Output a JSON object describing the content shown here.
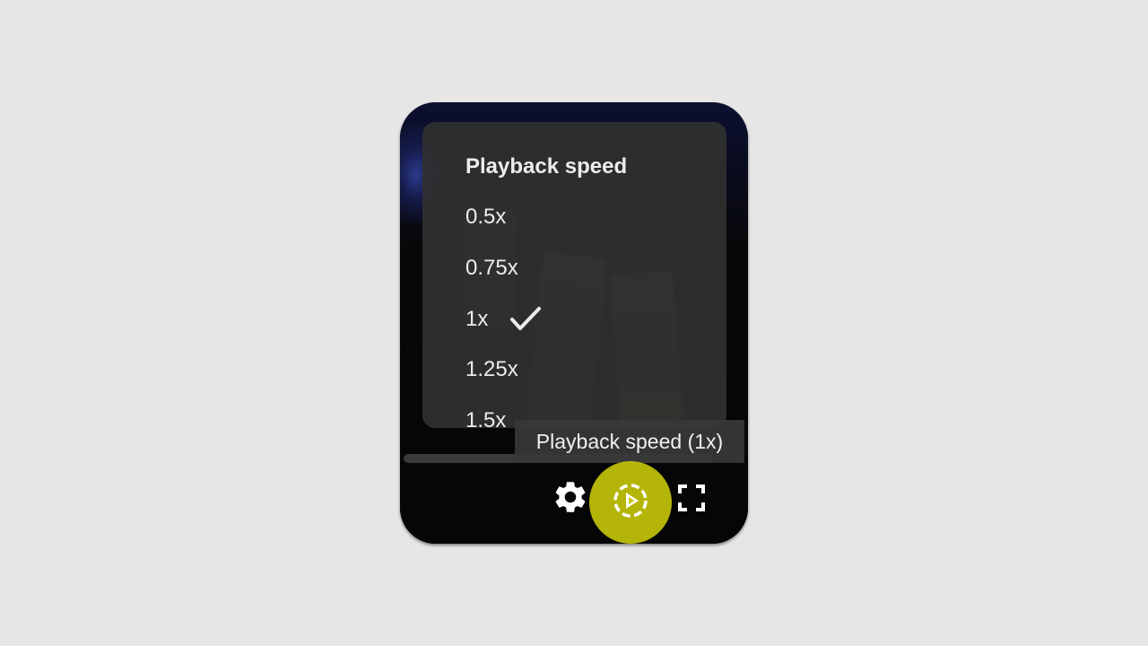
{
  "menu": {
    "title": "Playback speed",
    "options": [
      {
        "label": "0.5x",
        "selected": false
      },
      {
        "label": "0.75x",
        "selected": false
      },
      {
        "label": "1x",
        "selected": true
      },
      {
        "label": "1.25x",
        "selected": false
      },
      {
        "label": "1.5x",
        "selected": false
      }
    ]
  },
  "tooltip": {
    "text": "Playback speed (1x)"
  },
  "controls": {
    "settings_icon": "gear-icon",
    "speed_icon": "playback-speed-icon",
    "fullscreen_icon": "fullscreen-icon",
    "highlight_color": "#cdcd0a"
  },
  "colors": {
    "page_background": "#e6e6e6",
    "menu_background": "#303030",
    "text": "#ececec"
  }
}
